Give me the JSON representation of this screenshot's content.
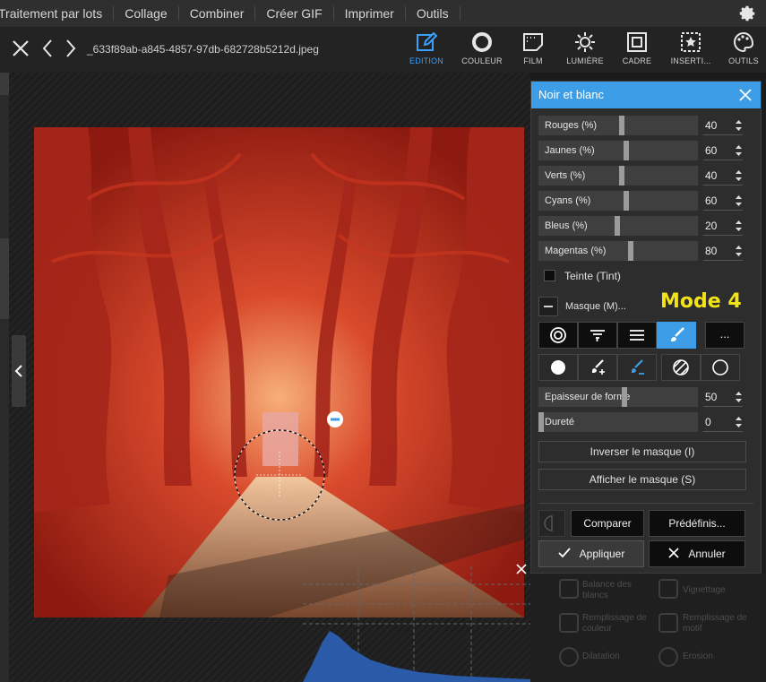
{
  "menubar": {
    "items": [
      "Traitement par lots",
      "Collage",
      "Combiner",
      "Créer GIF",
      "Imprimer",
      "Outils"
    ]
  },
  "toolbar": {
    "filename": "_633f89ab-a845-4857-97db-682728b5212d.jpeg",
    "tools": [
      {
        "label": "EDITION",
        "icon": "edit-icon",
        "active": true
      },
      {
        "label": "COULEUR",
        "icon": "color-circle-icon",
        "active": false
      },
      {
        "label": "FILM",
        "icon": "film-icon",
        "active": false
      },
      {
        "label": "LUMIÈRE",
        "icon": "sun-icon",
        "active": false
      },
      {
        "label": "CADRE",
        "icon": "frame-icon",
        "active": false
      },
      {
        "label": "INSERTI...",
        "icon": "insert-star-icon",
        "active": false
      },
      {
        "label": "OUTILS",
        "icon": "palette-icon",
        "active": false
      }
    ]
  },
  "panel": {
    "title": "Noir et blanc",
    "sliders": [
      {
        "label": "Rouges (%)",
        "value": "40",
        "level": 0.4
      },
      {
        "label": "Jaunes (%)",
        "value": "60",
        "level": 0.6
      },
      {
        "label": "Verts (%)",
        "value": "40",
        "level": 0.4
      },
      {
        "label": "Cyans (%)",
        "value": "60",
        "level": 0.6
      },
      {
        "label": "Bleus (%)",
        "value": "20",
        "level": 0.2
      },
      {
        "label": "Magentas (%)",
        "value": "80",
        "level": 0.8
      }
    ],
    "tint_label": "Teinte (Tint)",
    "mask_label": "Masque (M)...",
    "mode_label": "Mode 4",
    "more_label": "...",
    "shape_thickness": {
      "label": "Epaisseur de forme",
      "value": "50",
      "level": 0.5
    },
    "hardness": {
      "label": "Dureté",
      "value": "0",
      "level": 0.0
    },
    "invert_mask": "Inverser le masque (I)",
    "show_mask": "Afficher le masque (S)",
    "compare": "Comparer",
    "presets": "Prédéfinis...",
    "apply": "Appliquer",
    "cancel": "Annuler"
  },
  "under_panel": {
    "items": [
      "Balance des blancs",
      "Vignettage",
      "Remplissage de couleur",
      "Remplissage de motif",
      "Dilatation",
      "Erosion"
    ]
  },
  "colors": {
    "accent": "#3d9de6",
    "mode_text": "#f2e21a"
  }
}
